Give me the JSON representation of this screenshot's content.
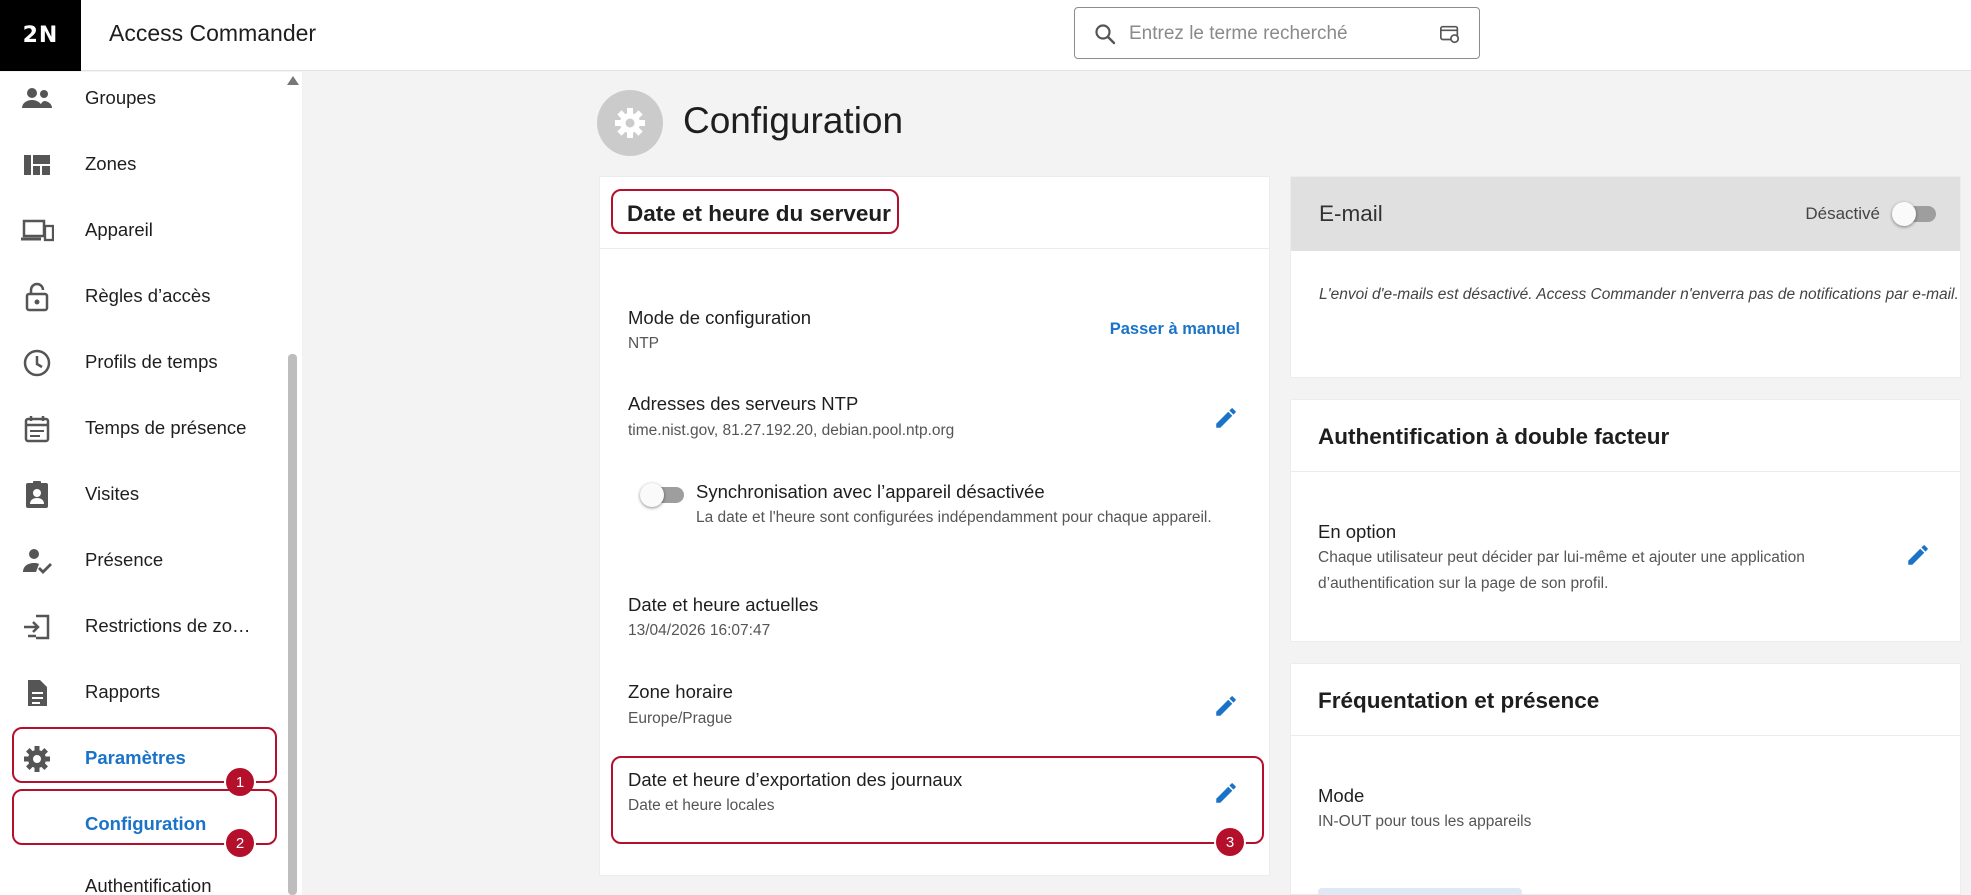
{
  "header": {
    "logo_text": "2N",
    "app_title": "Access Commander",
    "search_placeholder": "Entrez le terme recherché"
  },
  "sidebar": {
    "items": [
      {
        "label": "Groupes",
        "icon": "groups-icon"
      },
      {
        "label": "Zones",
        "icon": "zones-icon"
      },
      {
        "label": "Appareil",
        "icon": "devices-icon"
      },
      {
        "label": "Règles d’accès",
        "icon": "lock-icon"
      },
      {
        "label": "Profils de temps",
        "icon": "clock-icon"
      },
      {
        "label": "Temps de présence",
        "icon": "calendar-icon"
      },
      {
        "label": "Visites",
        "icon": "visitor-badge-icon"
      },
      {
        "label": "Présence",
        "icon": "person-check-icon"
      },
      {
        "label": "Restrictions de zo…",
        "icon": "zone-restriction-icon"
      },
      {
        "label": "Rapports",
        "icon": "document-icon"
      },
      {
        "label": "Paramètres",
        "icon": "gear-icon"
      }
    ],
    "sub_items": [
      {
        "label": "Configuration"
      },
      {
        "label": "Authentification"
      }
    ]
  },
  "badges": [
    "1",
    "2",
    "3"
  ],
  "page": {
    "title": "Configuration"
  },
  "server_time_card": {
    "title": "Date et heure du serveur",
    "mode_title": "Mode de configuration",
    "mode_value": "NTP",
    "mode_action": "Passer à manuel",
    "ntp_title": "Adresses des serveurs NTP",
    "ntp_value": "time.nist.gov, 81.27.192.20, debian.pool.ntp.org",
    "sync_title": "Synchronisation avec l’appareil désactivée",
    "sync_desc": "La date et l'heure sont configurées indépendamment pour chaque appareil.",
    "current_title": "Date et heure actuelles",
    "current_value": "13/04/2026 16:07:47",
    "tz_title": "Zone horaire",
    "tz_value": "Europe/Prague",
    "export_title": "Date et heure d’exportation des journaux",
    "export_value": "Date et heure locales"
  },
  "email_card": {
    "title": "E-mail",
    "state": "Désactivé",
    "text": "L'envoi d'e-mails est désactivé. Access Commander n'enverra pas de notifications par e-mail."
  },
  "twofa_card": {
    "title": "Authentification à double facteur",
    "option_title": "En option",
    "option_desc": "Chaque utilisateur peut décider par lui-même et ajouter une application d’authentification sur la page de son profil."
  },
  "attendance_card": {
    "title": "Fréquentation et présence",
    "mode_title": "Mode",
    "mode_value": "IN-OUT pour tous les appareils"
  },
  "colors": {
    "accent": "#1a73c9",
    "highlight": "#b5102b",
    "background": "#f3f3f3"
  }
}
